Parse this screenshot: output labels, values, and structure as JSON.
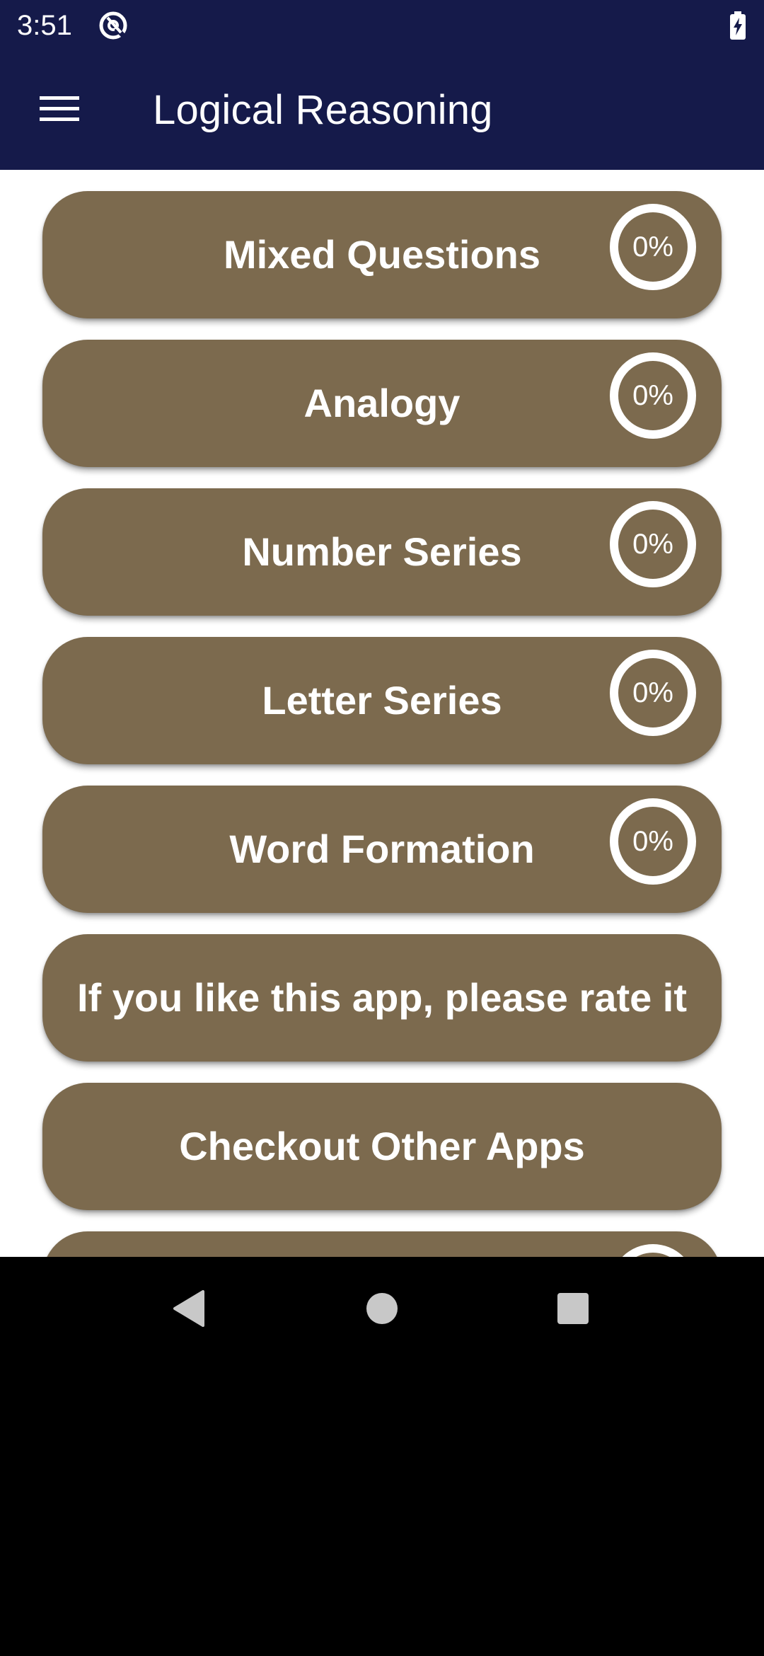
{
  "status_bar": {
    "time": "3:51",
    "app_icon": "at-sign-circle-icon",
    "battery_icon": "battery-charging-icon"
  },
  "app_bar": {
    "menu_icon": "hamburger-menu-icon",
    "title": "Logical Reasoning",
    "background_color": "#151a4a"
  },
  "categories": [
    {
      "label": "Mixed Questions",
      "progress": "0%"
    },
    {
      "label": "Analogy",
      "progress": "0%"
    },
    {
      "label": "Number Series",
      "progress": "0%"
    },
    {
      "label": "Letter Series",
      "progress": "0%"
    },
    {
      "label": "Word Formation",
      "progress": "0%"
    }
  ],
  "actions": {
    "rate": "If you like this app, please rate it",
    "other_apps": "Checkout Other Apps"
  },
  "theme": {
    "card_color": "#7c6a4e",
    "text_color": "#ffffff"
  },
  "nav_bar": {
    "back_icon": "back-triangle-icon",
    "home_icon": "home-circle-icon",
    "recents_icon": "recents-square-icon"
  }
}
